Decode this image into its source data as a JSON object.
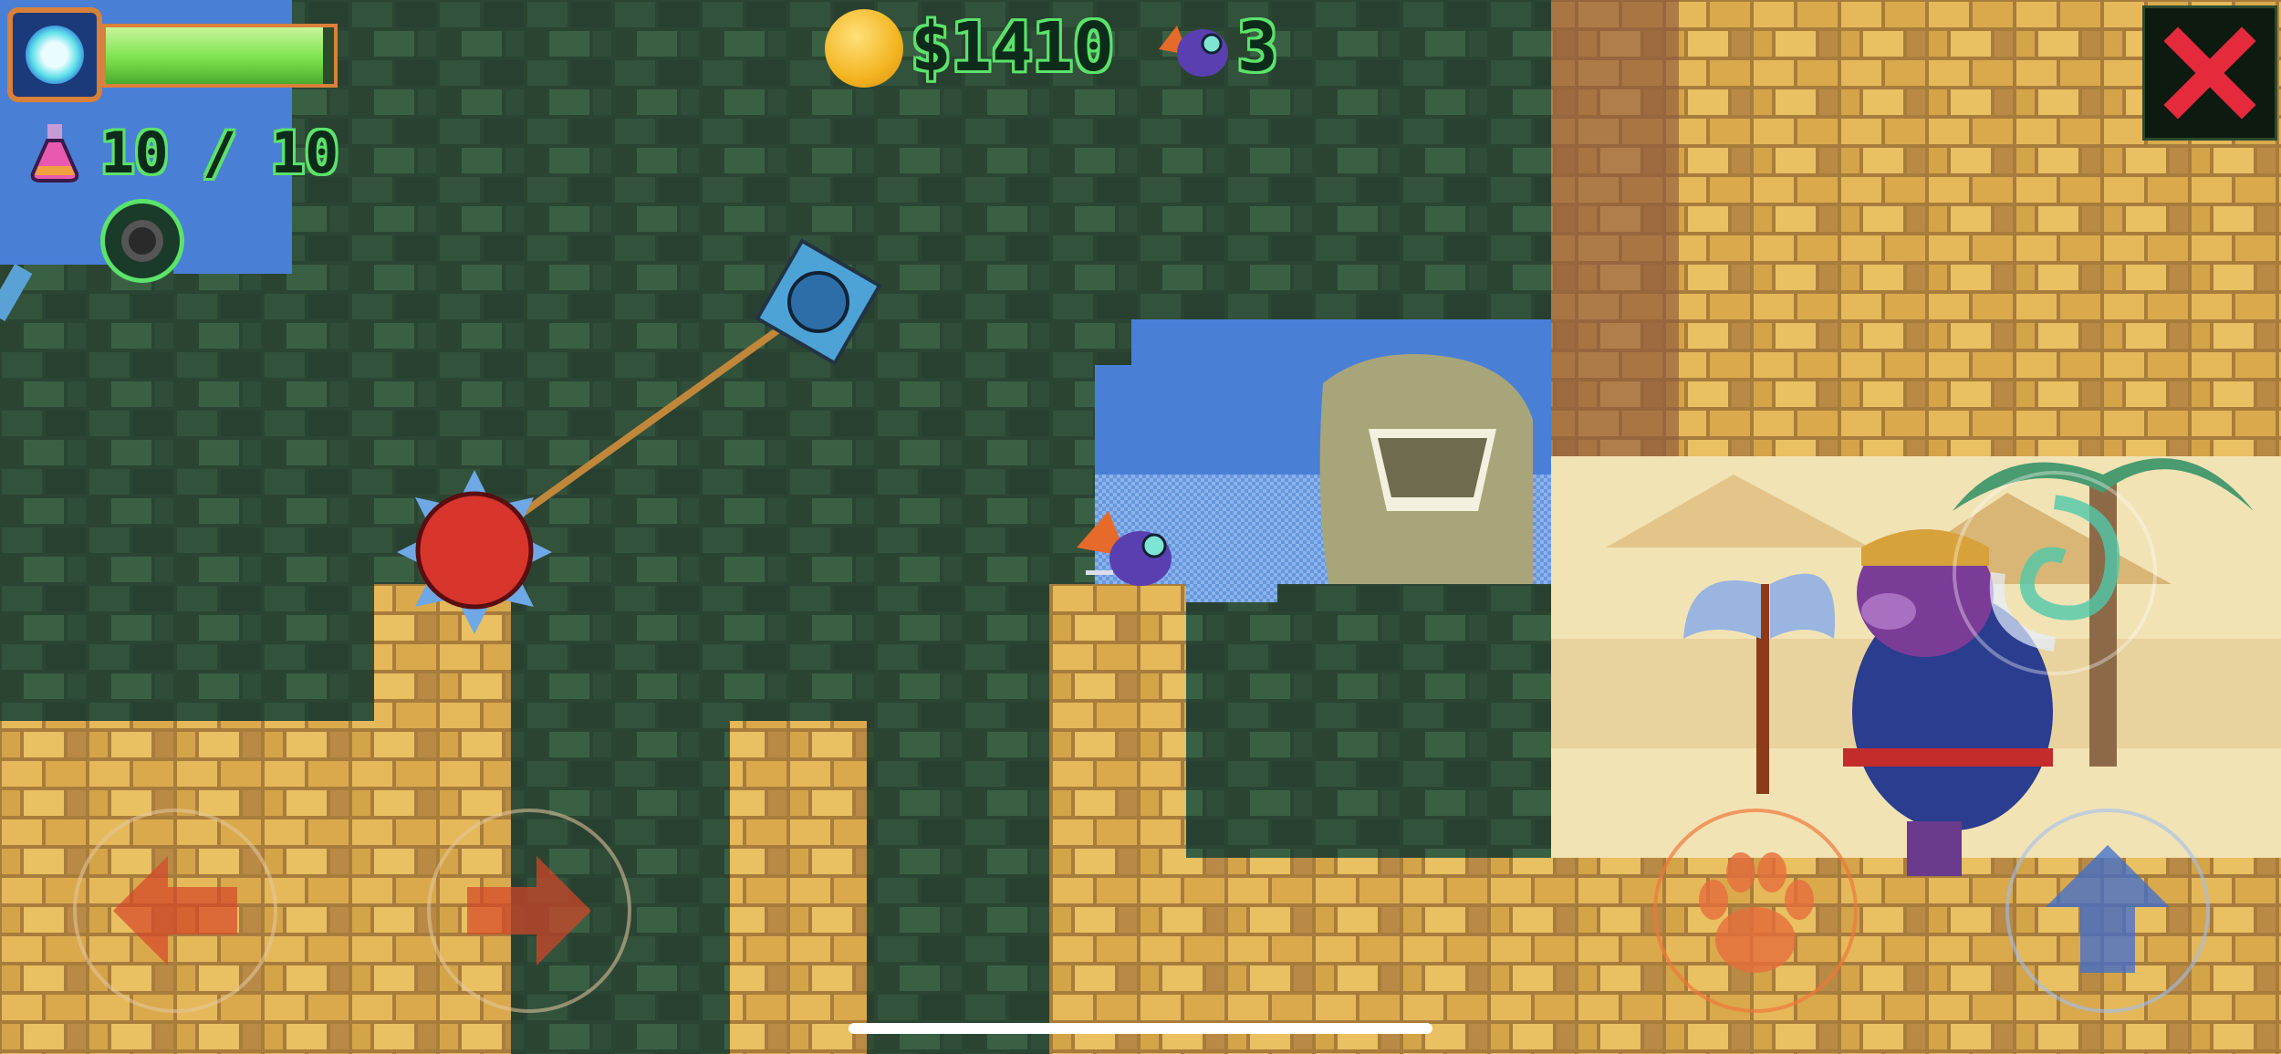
{
  "hud": {
    "health_fraction": 0.95,
    "potion_count": "10 / 10",
    "money": "$1410",
    "lives": "3"
  },
  "controls": {
    "close_icon": "close-icon",
    "left_icon": "arrow-left-icon",
    "right_icon": "arrow-right-icon",
    "attack_icon": "paw-icon",
    "jump_icon": "arrow-up-icon",
    "special_icon": "swirl-icon"
  },
  "colors": {
    "sky": "#4a7fd6",
    "dark_brick": "#2e4a35",
    "sand_brick": "#e0b655",
    "hud_text": "#5be36a",
    "health_bar": "#7be34d",
    "close_button": "#e52a3c"
  }
}
